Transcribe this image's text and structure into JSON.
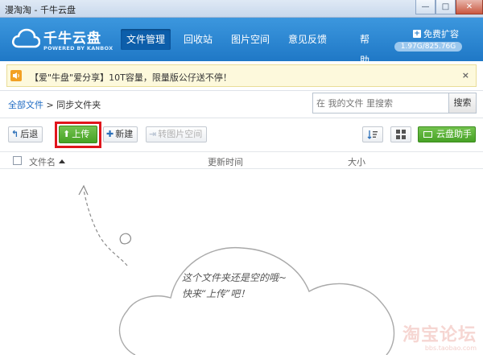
{
  "window": {
    "title": "漫淘淘 - 千牛云盘",
    "minimize": "—",
    "maximize": "□",
    "close": "✕"
  },
  "header": {
    "logo_title": "千牛云盘",
    "logo_sub": "POWERED BY KANBOX",
    "nav": [
      {
        "label": "文件管理",
        "active": true
      },
      {
        "label": "回收站"
      },
      {
        "label": "图片空间"
      },
      {
        "label": "意见反馈"
      },
      {
        "label": "帮助"
      }
    ],
    "expand_label": "免费扩容",
    "quota": "1.97G/825.76G"
  },
  "notice": {
    "text": "【爱\"牛盘\"爱分享】10T容量，限量版公仔送不停！",
    "close_label": "×"
  },
  "breadcrumb": {
    "root": "全部文件",
    "separator": ">",
    "current": "同步文件夹"
  },
  "search": {
    "placeholder": "在 我的文件 里搜索",
    "button_label": "搜索"
  },
  "toolbar": {
    "back_label": "后退",
    "upload_label": "上传",
    "new_label": "新建",
    "to_image_label": "转图片空间",
    "assistant_label": "云盘助手"
  },
  "table": {
    "col_name": "文件名",
    "col_time": "更新时间",
    "col_size": "大小"
  },
  "empty": {
    "line1": "这个文件夹还是空的哦~",
    "line2": "快来“上传”吧！"
  },
  "watermark": {
    "main": "淘宝论坛",
    "sub": "bbs.taobao.com"
  },
  "colors": {
    "header_blue": "#2a86d4",
    "upload_green": "#5bb23a",
    "highlight_red": "#e0151c",
    "notice_bg": "#fdf9dc"
  }
}
